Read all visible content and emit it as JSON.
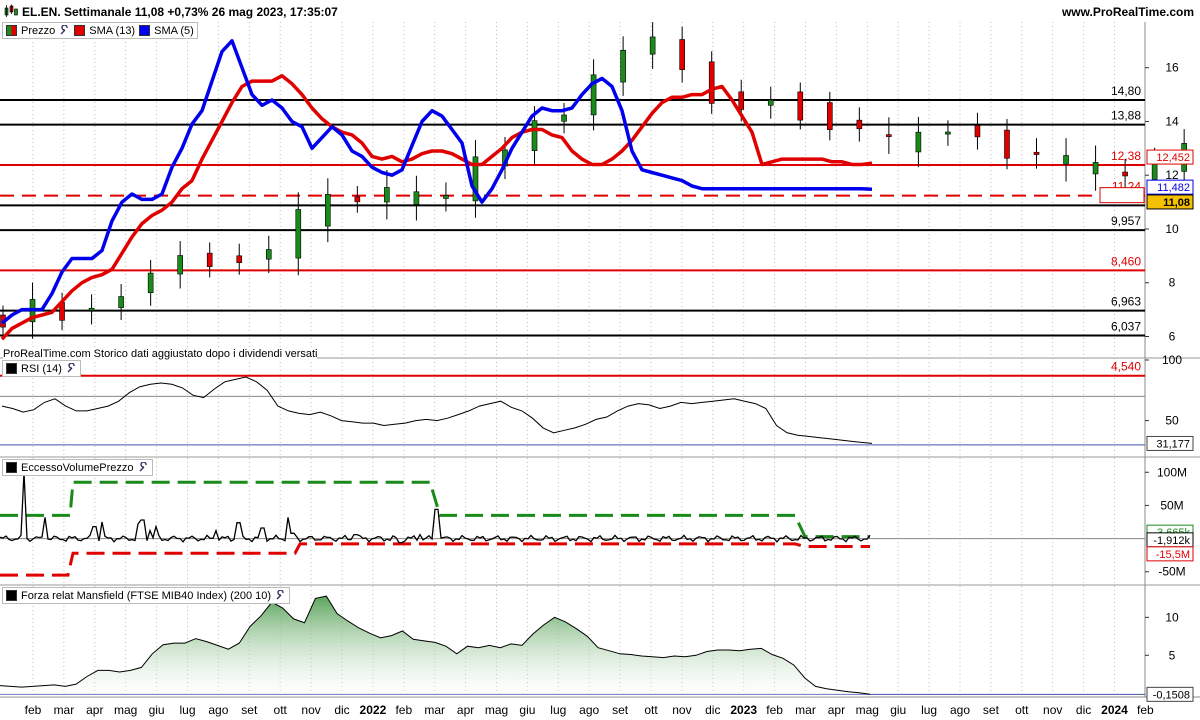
{
  "header": {
    "title": "EL.EN. Settimanale 11,08 +0,73% 26 mag 2023, 17:35:07",
    "site": "www.ProRealTime.com"
  },
  "legends": {
    "price": [
      {
        "label": "Prezzo",
        "swatch": "candles"
      },
      {
        "label": "SMA (13)",
        "color": "#e00000"
      },
      {
        "label": "SMA (5)",
        "color": "#0000ee"
      }
    ],
    "rsi": "RSI (14)",
    "volume": "EccessoVolumePrezzo",
    "mansfield": "Forza relat Mansfield (FTSE MIB40 Index) (200 10)"
  },
  "footnote": "ProRealTime.com  Storico dati aggiustato dopo i dividendi versati",
  "chart_data": [
    {
      "type": "line",
      "panel": "price",
      "ylim": [
        5.2,
        17.7
      ],
      "y_ticks": [
        "16",
        "14",
        "12",
        "10",
        "8",
        "6"
      ],
      "series": [
        {
          "name": "SMA (13)",
          "color": "#e00000",
          "x": [
            0,
            2,
            4,
            6,
            8,
            10,
            12,
            14,
            16,
            18,
            20,
            22,
            24,
            26,
            28,
            30,
            32,
            34,
            36,
            38,
            40,
            42,
            44,
            46,
            48,
            50,
            52,
            54,
            56,
            58,
            60,
            62,
            64,
            66,
            68,
            70,
            72,
            74,
            76,
            78,
            80,
            82,
            84,
            86,
            88,
            90,
            92,
            94,
            96,
            98,
            100,
            102,
            104,
            106,
            108,
            110,
            112,
            114,
            116,
            118,
            120,
            122,
            124,
            126,
            128,
            130,
            132,
            134,
            136,
            138,
            140,
            142,
            144,
            146,
            148,
            150,
            152,
            154,
            156,
            158,
            160,
            162,
            164,
            166,
            168,
            170,
            172,
            174
          ],
          "values": [
            5.9,
            6.3,
            6.5,
            6.7,
            6.8,
            6.9,
            7.3,
            7.7,
            8.0,
            8.2,
            8.3,
            8.5,
            9.1,
            9.7,
            10.2,
            10.5,
            10.7,
            11.0,
            11.5,
            11.8,
            12.6,
            13.3,
            14.0,
            14.7,
            15.3,
            15.5,
            15.5,
            15.5,
            15.7,
            15.4,
            15.0,
            14.5,
            14.1,
            13.8,
            13.6,
            13.5,
            13.2,
            12.7,
            12.6,
            12.7,
            12.5,
            12.6,
            12.8,
            12.9,
            12.9,
            12.8,
            12.6,
            12.4,
            12.4,
            12.7,
            13.0,
            13.4,
            13.6,
            13.7,
            13.7,
            13.5,
            13.4,
            12.9,
            12.6,
            12.4,
            12.4,
            12.6,
            12.9,
            13.3,
            13.8,
            14.3,
            14.7,
            14.9,
            14.9,
            15.0,
            15.0,
            15.2,
            15.3,
            14.8,
            14.2,
            13.6,
            12.4,
            12.5,
            12.6,
            12.6,
            12.6,
            12.6,
            12.6,
            12.5,
            12.5,
            12.4,
            12.4,
            12.45
          ]
        },
        {
          "name": "SMA (5)",
          "color": "#0000ee",
          "x": [
            0,
            2,
            4,
            6,
            8,
            10,
            12,
            14,
            16,
            18,
            20,
            22,
            24,
            26,
            28,
            30,
            32,
            34,
            36,
            38,
            40,
            42,
            44,
            46,
            48,
            50,
            52,
            54,
            56,
            58,
            60,
            62,
            64,
            66,
            68,
            70,
            72,
            74,
            76,
            78,
            80,
            82,
            84,
            86,
            88,
            90,
            92,
            94,
            96,
            98,
            100,
            102,
            104,
            106,
            108,
            110,
            112,
            114,
            116,
            118,
            120,
            122,
            124,
            126,
            128,
            130,
            132,
            134,
            136,
            138,
            140,
            142,
            144,
            146,
            148,
            150,
            152,
            154,
            156,
            158,
            160,
            162,
            164,
            166,
            168,
            170,
            172,
            174
          ],
          "values": [
            6.5,
            6.8,
            7.0,
            7.0,
            7.0,
            7.6,
            8.4,
            8.9,
            8.9,
            8.9,
            9.2,
            10.3,
            11.0,
            11.3,
            11.1,
            11.1,
            11.3,
            12.3,
            13.0,
            13.9,
            14.4,
            15.5,
            16.6,
            17.0,
            16.0,
            15.0,
            14.6,
            14.8,
            14.5,
            14.0,
            13.8,
            13.0,
            13.4,
            13.8,
            13.5,
            12.9,
            12.7,
            12.3,
            12.1,
            12.0,
            12.2,
            13.1,
            14.0,
            14.4,
            14.2,
            13.7,
            13.2,
            11.6,
            11.0,
            11.5,
            12.2,
            13.0,
            13.6,
            14.2,
            14.5,
            14.4,
            14.4,
            14.5,
            15.0,
            15.4,
            15.6,
            15.3,
            14.4,
            12.9,
            12.2,
            12.1,
            12.0,
            11.9,
            11.8,
            11.6,
            11.5,
            11.5,
            11.5,
            11.5,
            11.5,
            11.5,
            11.5,
            11.5,
            11.5,
            11.5,
            11.5,
            11.5,
            11.5,
            11.5,
            11.5,
            11.5,
            11.5,
            11.48
          ]
        }
      ],
      "levels": [
        {
          "label": "14,80",
          "value": 14.8,
          "color": "#000000"
        },
        {
          "label": "13,88",
          "value": 13.88,
          "color": "#000000"
        },
        {
          "label": "12,38",
          "value": 12.38,
          "color": "#e00000"
        },
        {
          "label": "11,24",
          "value": 11.24,
          "color": "#e00000",
          "dashed": true
        },
        {
          "label": "10,88",
          "value": 10.88,
          "color": "#000000"
        },
        {
          "label": "9,957",
          "value": 9.957,
          "color": "#000000"
        },
        {
          "label": "8,460",
          "value": 8.46,
          "color": "#e00000"
        },
        {
          "label": "6,963",
          "value": 6.963,
          "color": "#000000"
        },
        {
          "label": "6,037",
          "value": 6.037,
          "color": "#000000"
        },
        {
          "label": "4,540",
          "value": 4.54,
          "color": "#e00000"
        }
      ],
      "badges": [
        {
          "label": "12,452",
          "value": 12.452,
          "color": "#e00000"
        },
        {
          "label": "11,482",
          "value": 11.482,
          "color": "#0000ee"
        },
        {
          "label": "11,08",
          "value": 11.08,
          "color": "#000000",
          "highlight": "#f5c000"
        }
      ]
    },
    {
      "type": "line",
      "panel": "rsi",
      "ylim": [
        20,
        100
      ],
      "y_ticks": [
        "100",
        "50"
      ],
      "reference_lines": [
        70,
        30
      ],
      "series": [
        {
          "name": "RSI (14)",
          "color": "#000000",
          "values": [
            62,
            60,
            57,
            59,
            65,
            68,
            62,
            58,
            58,
            60,
            62,
            66,
            73,
            78,
            80,
            81,
            80,
            77,
            71,
            69,
            76,
            82,
            84,
            86,
            82,
            75,
            62,
            58,
            56,
            55,
            57,
            54,
            50,
            49,
            48,
            48,
            46,
            47,
            48,
            50,
            51,
            50,
            52,
            55,
            58,
            62,
            64,
            66,
            61,
            58,
            52,
            44,
            40,
            42,
            44,
            47,
            51,
            53,
            58,
            62,
            64,
            63,
            60,
            62,
            65,
            64,
            65,
            66,
            67,
            68,
            66,
            64,
            60,
            46,
            40,
            38,
            37,
            36,
            35,
            34,
            33,
            32,
            31.2
          ]
        }
      ],
      "badges": [
        {
          "label": "31,177",
          "value": 31.177
        }
      ]
    },
    {
      "type": "line",
      "panel": "volume",
      "ylim": [
        -70,
        120
      ],
      "y_ticks": [
        "100M",
        "50M",
        "-50M"
      ],
      "series": [
        {
          "name": "upper",
          "color": "#1a8a1a",
          "dashed": true
        },
        {
          "name": "lower",
          "color": "#e00000",
          "dashed": true
        },
        {
          "name": "EccessoVolumePrezzo",
          "color": "#000000"
        }
      ],
      "badges": [
        {
          "label": "3,665k",
          "value": 3.665,
          "color": "#1a8a1a"
        },
        {
          "label": "-1,912k",
          "value": -1.912,
          "color": "#000000"
        },
        {
          "label": "-15,5M",
          "value": -15.5,
          "color": "#e00000"
        }
      ]
    },
    {
      "type": "area",
      "panel": "mansfield",
      "ylim": [
        -0.5,
        14
      ],
      "y_ticks": [
        "10",
        "5"
      ],
      "series": [
        {
          "name": "Forza relat Mansfield",
          "color": "#000000",
          "values": [
            1,
            0.9,
            0.8,
            0.9,
            1.0,
            1.1,
            0.9,
            1.2,
            2.2,
            3.0,
            3.0,
            2.8,
            3.0,
            3.4,
            5.2,
            6.4,
            6.6,
            6.6,
            7.2,
            6.8,
            6.3,
            5.8,
            6.6,
            8.8,
            10.2,
            12.0,
            11.2,
            9.8,
            9.3,
            12.5,
            12.8,
            10.5,
            9.5,
            8.6,
            7.9,
            7.3,
            7.6,
            8.2,
            7.1,
            6.9,
            6.7,
            6.2,
            5.2,
            6.2,
            6.0,
            6.3,
            6.0,
            6.5,
            6.3,
            7.8,
            9.0,
            10.0,
            9.4,
            8.5,
            7.5,
            6.0,
            5.6,
            5.2,
            5.1,
            4.9,
            4.8,
            4.7,
            4.9,
            4.8,
            5.0,
            5.5,
            5.7,
            5.7,
            5.6,
            5.8,
            5.9,
            5.1,
            4.6,
            3.7,
            2.0,
            0.9,
            0.6,
            0.4,
            0.2,
            0.05,
            -0.15
          ]
        }
      ],
      "badges": [
        {
          "label": "-0,1508",
          "value": -0.1508
        }
      ]
    }
  ],
  "x_axis": {
    "labels": [
      {
        "text": "feb",
        "bold": false
      },
      {
        "text": "mar",
        "bold": false
      },
      {
        "text": "apr",
        "bold": false
      },
      {
        "text": "mag",
        "bold": false
      },
      {
        "text": "giu",
        "bold": false
      },
      {
        "text": "lug",
        "bold": false
      },
      {
        "text": "ago",
        "bold": false
      },
      {
        "text": "set",
        "bold": false
      },
      {
        "text": "ott",
        "bold": false
      },
      {
        "text": "nov",
        "bold": false
      },
      {
        "text": "dic",
        "bold": false
      },
      {
        "text": "2022",
        "bold": true
      },
      {
        "text": "feb",
        "bold": false
      },
      {
        "text": "mar",
        "bold": false
      },
      {
        "text": "apr",
        "bold": false
      },
      {
        "text": "mag",
        "bold": false
      },
      {
        "text": "giu",
        "bold": false
      },
      {
        "text": "lug",
        "bold": false
      },
      {
        "text": "ago",
        "bold": false
      },
      {
        "text": "set",
        "bold": false
      },
      {
        "text": "ott",
        "bold": false
      },
      {
        "text": "nov",
        "bold": false
      },
      {
        "text": "dic",
        "bold": false
      },
      {
        "text": "2023",
        "bold": true
      },
      {
        "text": "feb",
        "bold": false
      },
      {
        "text": "mar",
        "bold": false
      },
      {
        "text": "apr",
        "bold": false
      },
      {
        "text": "mag",
        "bold": false
      },
      {
        "text": "giu",
        "bold": false
      },
      {
        "text": "lug",
        "bold": false
      },
      {
        "text": "ago",
        "bold": false
      },
      {
        "text": "set",
        "bold": false
      },
      {
        "text": "ott",
        "bold": false
      },
      {
        "text": "nov",
        "bold": false
      },
      {
        "text": "dic",
        "bold": false
      },
      {
        "text": "2024",
        "bold": true
      },
      {
        "text": "feb",
        "bold": false
      }
    ]
  }
}
